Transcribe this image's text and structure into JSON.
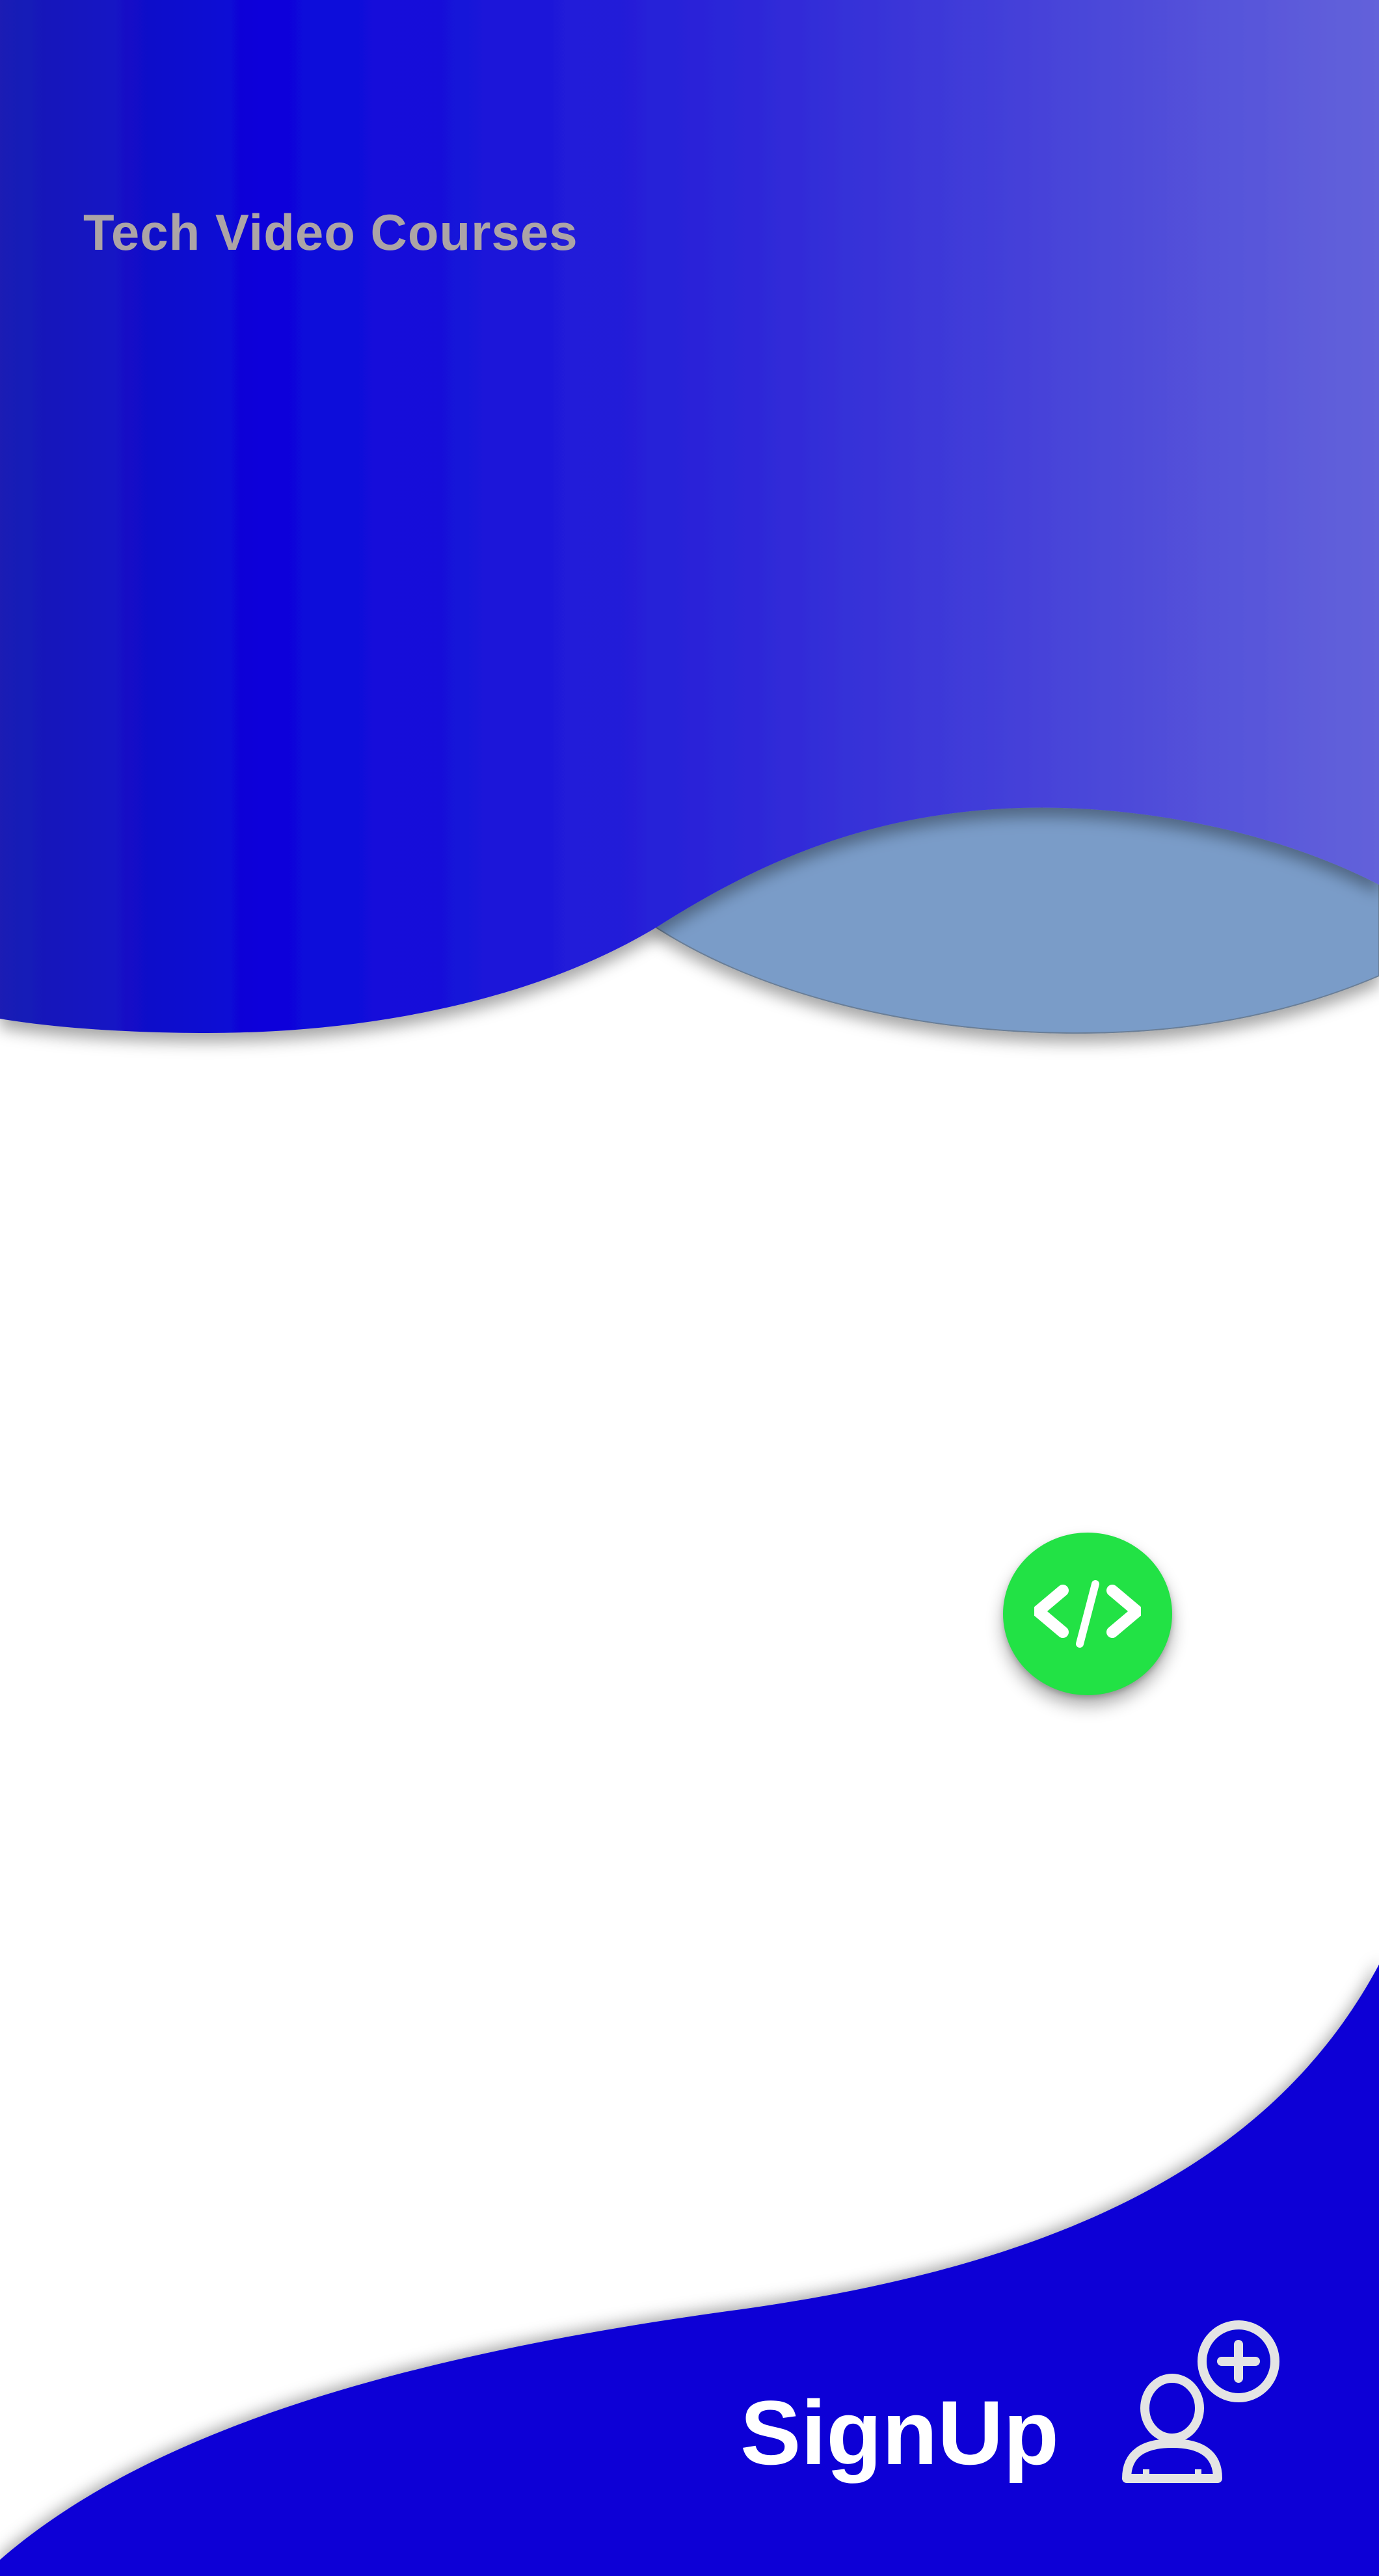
{
  "app": {
    "title": "Tech Video Courses"
  },
  "fab": {
    "icon": "code-icon"
  },
  "signup": {
    "label": "SignUp",
    "icon": "add-user-icon"
  },
  "colors": {
    "header_gradient_start": "#1A1DB4",
    "header_gradient_mid": "#0A04DA",
    "header_gradient_end": "#6362DA",
    "wave_accent": "#7A9CC8",
    "footer_wave": "#0A04D6",
    "fab_green": "#22E245",
    "title_gray": "#ACA4A6",
    "icon_light_gray": "#E4E4E4"
  }
}
